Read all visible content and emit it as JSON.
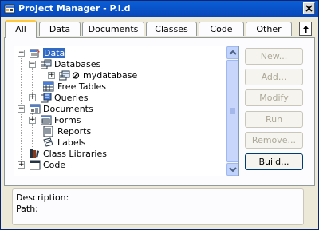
{
  "window": {
    "title": "Project Manager - P.i.d"
  },
  "tabs": [
    {
      "label": "All",
      "active": true
    },
    {
      "label": "Data"
    },
    {
      "label": "Documents"
    },
    {
      "label": "Classes"
    },
    {
      "label": "Code"
    },
    {
      "label": "Other"
    }
  ],
  "tree": {
    "data": "Data",
    "databases": "Databases",
    "mydatabase": "mydatabase",
    "free_tables": "Free Tables",
    "queries": "Queries",
    "documents": "Documents",
    "forms": "Forms",
    "reports": "Reports",
    "labels": "Labels",
    "class_libraries": "Class Libraries",
    "code": "Code"
  },
  "buttons": {
    "new": "New...",
    "add": "Add...",
    "modify": "Modify",
    "run": "Run",
    "remove": "Remove...",
    "build": "Build..."
  },
  "description": {
    "description_label": "Description:",
    "path_label": "Path:"
  },
  "colors": {
    "titlebar": "#0a5fd8",
    "selection": "#316ac5",
    "tab_highlight": "#ffc83c"
  }
}
